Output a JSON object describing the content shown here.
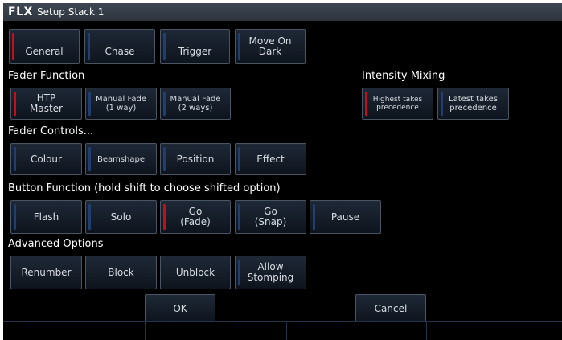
{
  "window": {
    "logo": "FLX",
    "title": "Setup Stack 1"
  },
  "tabs": [
    {
      "label": "General",
      "active": true
    },
    {
      "label": "Chase",
      "active": false
    },
    {
      "label": "Trigger",
      "active": false
    },
    {
      "label": "Move On\nDark",
      "active": false
    }
  ],
  "fader_function": {
    "heading": "Fader Function",
    "options": [
      {
        "label": "HTP\nMaster",
        "selected": true
      },
      {
        "label": "Manual Fade\n(1 way)",
        "selected": false
      },
      {
        "label": "Manual Fade\n(2 ways)",
        "selected": false
      }
    ]
  },
  "intensity_mixing": {
    "heading": "Intensity Mixing",
    "options": [
      {
        "label": "Highest takes\nprecedence",
        "selected": true
      },
      {
        "label": "Latest takes\nprecedence",
        "selected": false
      }
    ]
  },
  "fader_controls": {
    "heading": "Fader Controls...",
    "options": [
      {
        "label": "Colour",
        "selected": false
      },
      {
        "label": "Beamshape",
        "selected": false
      },
      {
        "label": "Position",
        "selected": false
      },
      {
        "label": "Effect",
        "selected": false
      }
    ]
  },
  "button_function": {
    "heading": "Button Function (hold shift to choose shifted option)",
    "options": [
      {
        "label": "Flash",
        "selected": false
      },
      {
        "label": "Solo",
        "selected": false
      },
      {
        "label": "Go\n(Fade)",
        "selected": true
      },
      {
        "label": "Go\n(Snap)",
        "selected": false
      },
      {
        "label": "Pause",
        "selected": false
      }
    ]
  },
  "advanced_options": {
    "heading": "Advanced Options",
    "options": [
      {
        "label": "Renumber"
      },
      {
        "label": "Block"
      },
      {
        "label": "Unblock"
      },
      {
        "label": "Allow\nStomping"
      }
    ]
  },
  "dialog_buttons": {
    "ok": "OK",
    "cancel": "Cancel"
  },
  "colors": {
    "selected_indicator": "#c40f1a",
    "unselected_indicator": "#203e70",
    "background": "#000000",
    "text": "#ffffff"
  }
}
